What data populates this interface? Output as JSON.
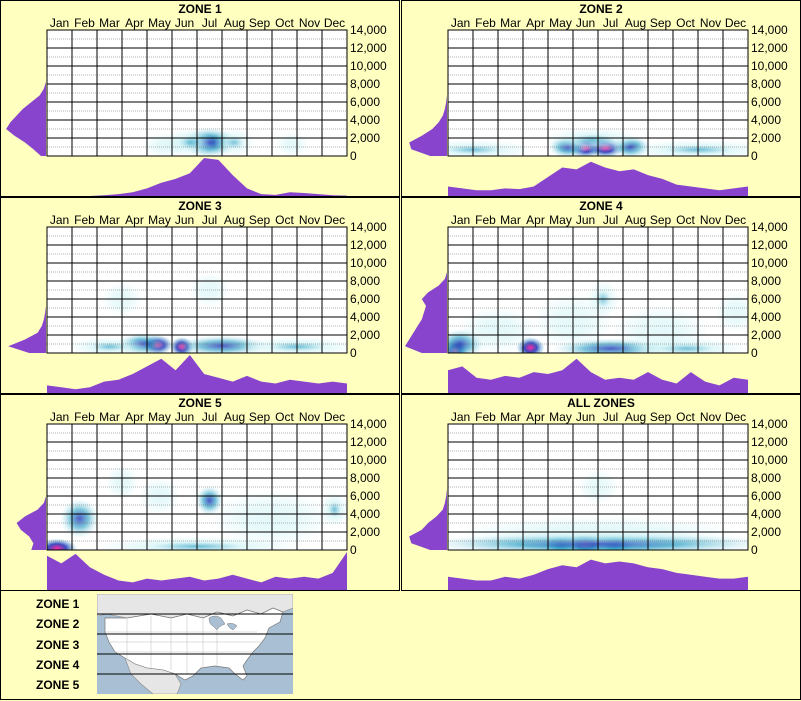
{
  "colors": {
    "background": "#ffffc0",
    "panel_border": "#000000",
    "profile_fill": "#8844cc",
    "heat_low": "#cff3f6",
    "heat_mid": "#3aa6c8",
    "heat_high": "#1c2fb6",
    "heat_peak": "#ff2aa0"
  },
  "chart_data": [
    {
      "type": "heatmap",
      "title": "ZONE 1",
      "x_categories": [
        "Jan",
        "Feb",
        "Mar",
        "Apr",
        "May",
        "Jun",
        "Jul",
        "Aug",
        "Sep",
        "Oct",
        "Nov",
        "Dec"
      ],
      "y_ticks": [
        "14,000",
        "12,000",
        "10,000",
        "8,000",
        "6,000",
        "4,000",
        "2,000",
        "0"
      ],
      "ylim": [
        0,
        14000
      ],
      "grid": true,
      "blobs": [
        {
          "month": 6.5,
          "elev": 1500,
          "intensity": 0.85,
          "spread_m": 0.7,
          "spread_e": 700
        },
        {
          "month": 5.7,
          "elev": 1500,
          "intensity": 0.45,
          "spread_m": 0.6,
          "spread_e": 600
        },
        {
          "month": 4.8,
          "elev": 1200,
          "intensity": 0.25,
          "spread_m": 0.6,
          "spread_e": 500
        },
        {
          "month": 7.5,
          "elev": 1500,
          "intensity": 0.3,
          "spread_m": 0.5,
          "spread_e": 600
        },
        {
          "month": 9.8,
          "elev": 1300,
          "intensity": 0.18,
          "spread_m": 0.4,
          "spread_e": 500
        }
      ],
      "elev_profile": [
        0.0,
        0.0,
        0.0,
        0.0,
        0.0,
        0.0,
        0.0,
        0.0,
        0.0,
        0.05,
        0.15,
        0.35,
        0.55,
        0.7,
        0.85,
        0.95,
        0.75,
        0.5,
        0.3,
        0.12
      ],
      "month_profile": [
        0.0,
        0.0,
        0.0,
        0.0,
        0.02,
        0.05,
        0.1,
        0.2,
        0.35,
        0.45,
        0.6,
        1.0,
        0.95,
        0.55,
        0.2,
        0.05,
        0.03,
        0.1,
        0.08,
        0.05,
        0.02,
        0.01
      ]
    },
    {
      "type": "heatmap",
      "title": "ZONE 2",
      "x_categories": [
        "Jan",
        "Feb",
        "Mar",
        "Apr",
        "May",
        "Jun",
        "Jul",
        "Aug",
        "Sep",
        "Oct",
        "Nov",
        "Dec"
      ],
      "y_ticks": [
        "14,000",
        "12,000",
        "10,000",
        "8,000",
        "6,000",
        "4,000",
        "2,000",
        "0"
      ],
      "ylim": [
        0,
        14000
      ],
      "grid": true,
      "blobs": [
        {
          "month": 5.5,
          "elev": 900,
          "intensity": 1.0,
          "spread_m": 0.4,
          "spread_e": 350
        },
        {
          "month": 6.3,
          "elev": 900,
          "intensity": 0.95,
          "spread_m": 0.45,
          "spread_e": 350
        },
        {
          "month": 4.8,
          "elev": 1000,
          "intensity": 0.7,
          "spread_m": 0.5,
          "spread_e": 450
        },
        {
          "month": 7.3,
          "elev": 1000,
          "intensity": 0.7,
          "spread_m": 0.5,
          "spread_e": 450
        },
        {
          "month": 1.0,
          "elev": 700,
          "intensity": 0.45,
          "spread_m": 1.5,
          "spread_e": 350
        },
        {
          "month": 10.0,
          "elev": 700,
          "intensity": 0.5,
          "spread_m": 1.8,
          "spread_e": 350
        },
        {
          "month": 5.8,
          "elev": 1800,
          "intensity": 0.45,
          "spread_m": 1.2,
          "spread_e": 500
        }
      ],
      "elev_profile": [
        0.0,
        0.0,
        0.0,
        0.0,
        0.0,
        0.0,
        0.0,
        0.0,
        0.0,
        0.0,
        0.0,
        0.02,
        0.05,
        0.1,
        0.2,
        0.35,
        0.6,
        0.9,
        0.85,
        0.4
      ],
      "month_profile": [
        0.25,
        0.2,
        0.15,
        0.15,
        0.2,
        0.18,
        0.25,
        0.5,
        0.75,
        0.7,
        0.9,
        0.75,
        0.65,
        0.7,
        0.55,
        0.45,
        0.3,
        0.25,
        0.2,
        0.15,
        0.2,
        0.25
      ]
    },
    {
      "type": "heatmap",
      "title": "ZONE 3",
      "x_categories": [
        "Jan",
        "Feb",
        "Mar",
        "Apr",
        "May",
        "Jun",
        "Jul",
        "Aug",
        "Sep",
        "Oct",
        "Nov",
        "Dec"
      ],
      "y_ticks": [
        "14,000",
        "12,000",
        "10,000",
        "8,000",
        "6,000",
        "4,000",
        "2,000",
        "0"
      ],
      "ylim": [
        0,
        14000
      ],
      "grid": true,
      "blobs": [
        {
          "month": 4.4,
          "elev": 900,
          "intensity": 1.0,
          "spread_m": 0.4,
          "spread_e": 350
        },
        {
          "month": 5.4,
          "elev": 700,
          "intensity": 1.0,
          "spread_m": 0.3,
          "spread_e": 350
        },
        {
          "month": 3.8,
          "elev": 1000,
          "intensity": 0.6,
          "spread_m": 0.6,
          "spread_e": 450
        },
        {
          "month": 7.0,
          "elev": 800,
          "intensity": 0.55,
          "spread_m": 1.2,
          "spread_e": 400
        },
        {
          "month": 2.5,
          "elev": 700,
          "intensity": 0.45,
          "spread_m": 1.0,
          "spread_e": 350
        },
        {
          "month": 10.0,
          "elev": 700,
          "intensity": 0.5,
          "spread_m": 1.5,
          "spread_e": 350
        },
        {
          "month": 6.5,
          "elev": 7000,
          "intensity": 0.15,
          "spread_m": 0.5,
          "spread_e": 800
        },
        {
          "month": 3.0,
          "elev": 6000,
          "intensity": 0.12,
          "spread_m": 0.5,
          "spread_e": 800
        }
      ],
      "elev_profile": [
        0.0,
        0.0,
        0.0,
        0.0,
        0.0,
        0.0,
        0.0,
        0.0,
        0.0,
        0.0,
        0.0,
        0.0,
        0.0,
        0.02,
        0.05,
        0.1,
        0.2,
        0.5,
        0.9,
        0.4
      ],
      "month_profile": [
        0.2,
        0.15,
        0.1,
        0.15,
        0.3,
        0.35,
        0.5,
        0.7,
        0.9,
        0.6,
        1.0,
        0.5,
        0.4,
        0.3,
        0.45,
        0.3,
        0.25,
        0.35,
        0.3,
        0.25,
        0.3,
        0.25
      ]
    },
    {
      "type": "heatmap",
      "title": "ZONE 4",
      "x_categories": [
        "Jan",
        "Feb",
        "Mar",
        "Apr",
        "May",
        "Jun",
        "Jul",
        "Aug",
        "Sep",
        "Oct",
        "Nov",
        "Dec"
      ],
      "y_ticks": [
        "14,000",
        "12,000",
        "10,000",
        "8,000",
        "6,000",
        "4,000",
        "2,000",
        "0"
      ],
      "ylim": [
        0,
        14000
      ],
      "grid": true,
      "blobs": [
        {
          "month": 0.3,
          "elev": 300,
          "intensity": 1.0,
          "spread_m": 0.3,
          "spread_e": 400
        },
        {
          "month": 3.3,
          "elev": 600,
          "intensity": 0.95,
          "spread_m": 0.35,
          "spread_e": 400
        },
        {
          "month": 0.5,
          "elev": 1000,
          "intensity": 0.6,
          "spread_m": 0.6,
          "spread_e": 700
        },
        {
          "month": 6.2,
          "elev": 6000,
          "intensity": 0.3,
          "spread_m": 0.4,
          "spread_e": 900
        },
        {
          "month": 6.5,
          "elev": 500,
          "intensity": 0.55,
          "spread_m": 1.5,
          "spread_e": 400
        },
        {
          "month": 9.5,
          "elev": 500,
          "intensity": 0.5,
          "spread_m": 1.5,
          "spread_e": 400
        },
        {
          "month": 2.0,
          "elev": 2500,
          "intensity": 0.18,
          "spread_m": 1.0,
          "spread_e": 1200
        },
        {
          "month": 5.0,
          "elev": 3500,
          "intensity": 0.15,
          "spread_m": 1.0,
          "spread_e": 1500
        },
        {
          "month": 8.5,
          "elev": 2500,
          "intensity": 0.15,
          "spread_m": 1.2,
          "spread_e": 1300
        },
        {
          "month": 11.5,
          "elev": 4500,
          "intensity": 0.15,
          "spread_m": 0.5,
          "spread_e": 1000
        }
      ],
      "elev_profile": [
        0.0,
        0.0,
        0.0,
        0.0,
        0.0,
        0.0,
        0.0,
        0.0,
        0.05,
        0.2,
        0.45,
        0.6,
        0.5,
        0.55,
        0.6,
        0.7,
        0.8,
        0.9,
        1.0,
        0.6
      ],
      "month_profile": [
        0.6,
        0.7,
        0.4,
        0.35,
        0.45,
        0.4,
        0.55,
        0.5,
        0.6,
        0.9,
        0.55,
        0.35,
        0.4,
        0.35,
        0.55,
        0.35,
        0.25,
        0.55,
        0.3,
        0.2,
        0.4,
        0.35
      ]
    },
    {
      "type": "heatmap",
      "title": "ZONE 5",
      "x_categories": [
        "Jan",
        "Feb",
        "Mar",
        "Apr",
        "May",
        "Jun",
        "Jul",
        "Aug",
        "Sep",
        "Oct",
        "Nov",
        "Dec"
      ],
      "y_ticks": [
        "14,000",
        "12,000",
        "10,000",
        "8,000",
        "6,000",
        "4,000",
        "2,000",
        "0"
      ],
      "ylim": [
        0,
        14000
      ],
      "grid": true,
      "blobs": [
        {
          "month": 0.4,
          "elev": 200,
          "intensity": 1.0,
          "spread_m": 0.5,
          "spread_e": 350
        },
        {
          "month": 1.3,
          "elev": 3500,
          "intensity": 0.55,
          "spread_m": 0.5,
          "spread_e": 1000
        },
        {
          "month": 6.5,
          "elev": 5500,
          "intensity": 0.6,
          "spread_m": 0.35,
          "spread_e": 700
        },
        {
          "month": 11.5,
          "elev": 4500,
          "intensity": 0.45,
          "spread_m": 0.35,
          "spread_e": 800
        },
        {
          "month": 6.0,
          "elev": 400,
          "intensity": 0.5,
          "spread_m": 2.5,
          "spread_e": 350
        },
        {
          "month": 3.0,
          "elev": 7500,
          "intensity": 0.2,
          "spread_m": 0.4,
          "spread_e": 800
        },
        {
          "month": 4.5,
          "elev": 6000,
          "intensity": 0.18,
          "spread_m": 0.5,
          "spread_e": 900
        },
        {
          "month": 9.0,
          "elev": 3500,
          "intensity": 0.18,
          "spread_m": 1.5,
          "spread_e": 1500
        }
      ],
      "elev_profile": [
        0.0,
        0.0,
        0.0,
        0.0,
        0.0,
        0.0,
        0.0,
        0.0,
        0.0,
        0.0,
        0.0,
        0.0,
        0.05,
        0.2,
        0.5,
        0.7,
        0.6,
        0.4,
        0.3,
        0.35
      ],
      "month_profile": [
        0.9,
        0.7,
        0.95,
        0.6,
        0.4,
        0.25,
        0.2,
        0.3,
        0.25,
        0.3,
        0.35,
        0.25,
        0.3,
        0.4,
        0.3,
        0.2,
        0.35,
        0.3,
        0.35,
        0.3,
        0.45,
        1.0
      ]
    },
    {
      "type": "heatmap",
      "title": "ALL ZONES",
      "x_categories": [
        "Jan",
        "Feb",
        "Mar",
        "Apr",
        "May",
        "Jun",
        "Jul",
        "Aug",
        "Sep",
        "Oct",
        "Nov",
        "Dec"
      ],
      "y_ticks": [
        "14,000",
        "12,000",
        "10,000",
        "8,000",
        "6,000",
        "4,000",
        "2,000",
        "0"
      ],
      "ylim": [
        0,
        14000
      ],
      "grid": true,
      "blobs": [
        {
          "month": 5.5,
          "elev": 600,
          "intensity": 0.95,
          "spread_m": 0.45,
          "spread_e": 350
        },
        {
          "month": 4.5,
          "elev": 600,
          "intensity": 0.85,
          "spread_m": 0.45,
          "spread_e": 350
        },
        {
          "month": 6.7,
          "elev": 600,
          "intensity": 0.85,
          "spread_m": 0.5,
          "spread_e": 350
        },
        {
          "month": 6.0,
          "elev": 700,
          "intensity": 0.75,
          "spread_m": 4.5,
          "spread_e": 450
        },
        {
          "month": 6.0,
          "elev": 2000,
          "intensity": 0.22,
          "spread_m": 3.5,
          "spread_e": 700
        },
        {
          "month": 6.0,
          "elev": 7000,
          "intensity": 0.12,
          "spread_m": 0.5,
          "spread_e": 800
        }
      ],
      "elev_profile": [
        0.0,
        0.0,
        0.0,
        0.0,
        0.0,
        0.0,
        0.0,
        0.0,
        0.0,
        0.0,
        0.0,
        0.02,
        0.05,
        0.1,
        0.25,
        0.45,
        0.6,
        0.9,
        0.85,
        0.4
      ],
      "month_profile": [
        0.35,
        0.3,
        0.25,
        0.25,
        0.35,
        0.3,
        0.4,
        0.55,
        0.65,
        0.6,
        0.8,
        0.7,
        0.75,
        0.7,
        0.6,
        0.55,
        0.45,
        0.4,
        0.35,
        0.3,
        0.3,
        0.35
      ]
    }
  ],
  "legend": {
    "zones": [
      "ZONE 1",
      "ZONE 2",
      "ZONE 3",
      "ZONE 4",
      "ZONE 5"
    ],
    "zone_lines": 4
  }
}
